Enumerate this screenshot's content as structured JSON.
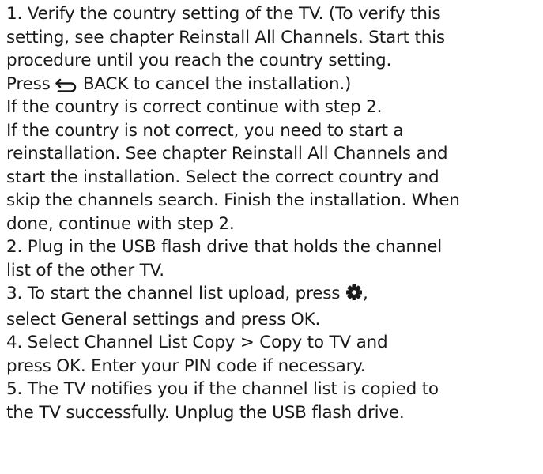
{
  "lines": {
    "l1": "1. Verify the country setting of the TV. (To verify this",
    "l2": "setting, see chapter Reinstall All Channels. Start this",
    "l3": "procedure until you reach the country setting.",
    "l4_pre": "Press ",
    "l4_back": "BACK",
    "l4_post": " to cancel the installation.)",
    "l5": "If the country is correct continue with step 2.",
    "l6": "If the country is not correct, you need to start a",
    "l7": "reinstallation. See chapter Reinstall All Channels and",
    "l8": "start the installation. Select the correct country and",
    "l9": "skip the channels search. Finish the installation. When",
    "l10": "done, continue with step 2.",
    "l11": "2. Plug in the USB flash drive that holds the channel",
    "l12": "list of the other TV.",
    "l13_pre": "3. To start the channel list upload, press ",
    "l13_post": ",",
    "l14_a": "select ",
    "l14_b": "General settings",
    "l14_c": " and press ",
    "l14_d": "OK",
    "l14_e": ".",
    "l15_a": "4. Select ",
    "l15_b": "Channel List Copy",
    "l15_c": " > ",
    "l15_d": "Copy to TV",
    "l15_e": " and",
    "l16_a": "press ",
    "l16_b": "OK",
    "l16_c": ". Enter your PIN code if necessary.",
    "l17": "5. The TV notifies you if the channel list is copied to",
    "l18": "the TV successfully. Unplug the USB flash drive."
  },
  "icons": {
    "back": "back-arrow-icon",
    "settings": "gear-icon"
  }
}
